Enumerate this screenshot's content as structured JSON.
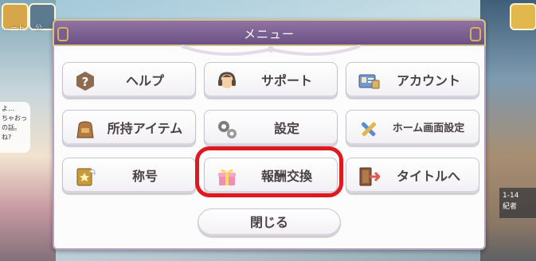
{
  "background": {
    "top_left_label": "…ート",
    "top_left_label2": "公",
    "chat_lines": [
      "よ…",
      "ちゃおっ",
      "の話。",
      "ね?"
    ],
    "info_lines": [
      "1-14",
      "紀者"
    ]
  },
  "menu": {
    "title": "メニュー",
    "buttons": [
      {
        "label": "ヘルプ",
        "icon": "question-icon"
      },
      {
        "label": "サポート",
        "icon": "headset-icon"
      },
      {
        "label": "アカウント",
        "icon": "account-card-icon"
      },
      {
        "label": "所持アイテム",
        "icon": "bag-icon"
      },
      {
        "label": "設定",
        "icon": "gears-icon"
      },
      {
        "label": "ホーム画面設定",
        "icon": "brush-icon"
      },
      {
        "label": "称号",
        "icon": "title-badge-icon"
      },
      {
        "label": "報酬交換",
        "icon": "gift-icon"
      },
      {
        "label": "タイトルへ",
        "icon": "exit-door-icon"
      }
    ],
    "close_label": "閉じる",
    "highlighted_item": "報酬交換"
  },
  "colors": {
    "header": "#6c5285",
    "highlight": "#e0191e",
    "button_text": "#4a4146"
  }
}
